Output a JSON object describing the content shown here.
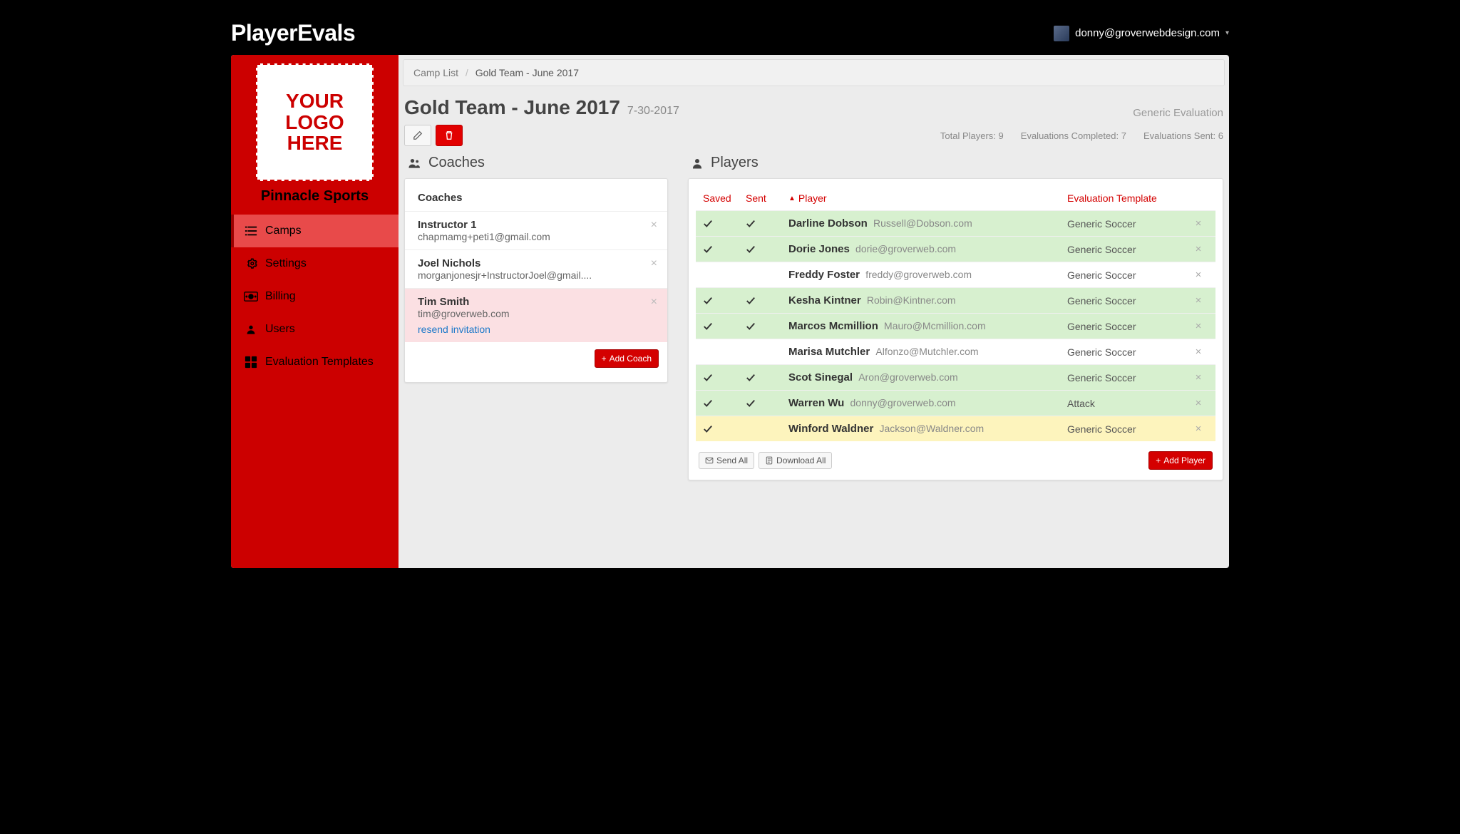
{
  "brand": "PlayerEvals",
  "user_email": "donny@groverwebdesign.com",
  "logo_placeholder": "YOUR LOGO HERE",
  "org_name": "Pinnacle Sports",
  "nav": [
    {
      "label": "Camps",
      "active": true
    },
    {
      "label": "Settings",
      "active": false
    },
    {
      "label": "Billing",
      "active": false
    },
    {
      "label": "Users",
      "active": false
    },
    {
      "label": "Evaluation Templates",
      "active": false
    }
  ],
  "breadcrumb_root": "Camp List",
  "breadcrumb_current": "Gold Team - June 2017",
  "page_title": "Gold Team - June 2017",
  "page_date": "7-30-2017",
  "evaluation_label": "Generic Evaluation",
  "stats": {
    "total_players_label": "Total Players:",
    "total_players_value": "9",
    "completed_label": "Evaluations Completed:",
    "completed_value": "7",
    "sent_label": "Evaluations Sent:",
    "sent_value": "6"
  },
  "coaches_heading": "Coaches",
  "coaches_subheading": "Coaches",
  "coaches": [
    {
      "name": "Instructor 1",
      "email": "chapmamg+peti1@gmail.com",
      "pending": false
    },
    {
      "name": "Joel Nichols",
      "email": "morganjonesjr+InstructorJoel@gmail....",
      "pending": false
    },
    {
      "name": "Tim Smith",
      "email": "tim@groverweb.com",
      "pending": true
    }
  ],
  "resend_label": "resend invitation",
  "add_coach_label": "Add Coach",
  "players_heading": "Players",
  "players_columns": {
    "saved": "Saved",
    "sent": "Sent",
    "player": "Player",
    "template": "Evaluation Template"
  },
  "players": [
    {
      "saved": true,
      "sent": true,
      "name": "Darline Dobson",
      "email": "Russell@Dobson.com",
      "template": "Generic Soccer",
      "status": "green"
    },
    {
      "saved": true,
      "sent": true,
      "name": "Dorie Jones",
      "email": "dorie@groverweb.com",
      "template": "Generic Soccer",
      "status": "green"
    },
    {
      "saved": false,
      "sent": false,
      "name": "Freddy Foster",
      "email": "freddy@groverweb.com",
      "template": "Generic Soccer",
      "status": "none"
    },
    {
      "saved": true,
      "sent": true,
      "name": "Kesha Kintner",
      "email": "Robin@Kintner.com",
      "template": "Generic Soccer",
      "status": "green"
    },
    {
      "saved": true,
      "sent": true,
      "name": "Marcos Mcmillion",
      "email": "Mauro@Mcmillion.com",
      "template": "Generic Soccer",
      "status": "green"
    },
    {
      "saved": false,
      "sent": false,
      "name": "Marisa Mutchler",
      "email": "Alfonzo@Mutchler.com",
      "template": "Generic Soccer",
      "status": "none"
    },
    {
      "saved": true,
      "sent": true,
      "name": "Scot Sinegal",
      "email": "Aron@groverweb.com",
      "template": "Generic Soccer",
      "status": "green"
    },
    {
      "saved": true,
      "sent": true,
      "name": "Warren Wu",
      "email": "donny@groverweb.com",
      "template": "Attack",
      "status": "green"
    },
    {
      "saved": true,
      "sent": false,
      "name": "Winford Waldner",
      "email": "Jackson@Waldner.com",
      "template": "Generic Soccer",
      "status": "yellow"
    }
  ],
  "send_all_label": "Send All",
  "download_all_label": "Download All",
  "add_player_label": "Add Player"
}
